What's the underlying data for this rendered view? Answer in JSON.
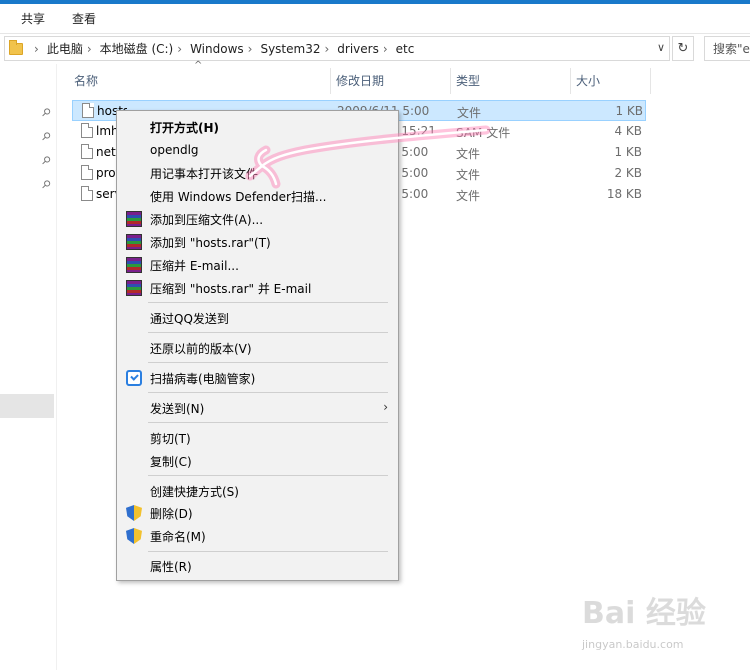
{
  "ribbon": {
    "tabs": [
      "共享",
      "查看"
    ]
  },
  "address": {
    "crumbs": [
      "此电脑",
      "本地磁盘 (C:)",
      "Windows",
      "System32",
      "drivers",
      "etc"
    ],
    "separator": "›",
    "dropdown_glyph": "∨",
    "refresh_glyph": "↻"
  },
  "search": {
    "text": "搜索\"e"
  },
  "columns": {
    "name": "名称",
    "date": "修改日期",
    "type": "类型",
    "size": "大小",
    "sort_glyph": "^"
  },
  "files": [
    {
      "name": "hosts",
      "date": "2009/6/11 5:00",
      "type": "文件",
      "size": "1 KB"
    },
    {
      "name": "lmhosts.sam",
      "date": "2009/6/11 15:21",
      "type": "SAM 文件",
      "size": "4 KB"
    },
    {
      "name": "networks",
      "date": "2009/6/11 5:00",
      "type": "文件",
      "size": "1 KB"
    },
    {
      "name": "protocol",
      "date": "2009/6/11 5:00",
      "type": "文件",
      "size": "2 KB"
    },
    {
      "name": "services",
      "date": "2009/6/11 5:00",
      "type": "文件",
      "size": "18 KB"
    }
  ],
  "context_menu": {
    "open_with": "打开方式(H)",
    "opendlg": "opendlg",
    "open_notepad": "用记事本打开该文件",
    "defender": "使用 Windows Defender扫描...",
    "rar_add": "添加到压缩文件(A)...",
    "rar_add_hosts": "添加到 \"hosts.rar\"(T)",
    "rar_email": "压缩并 E-mail...",
    "rar_hosts_email": "压缩到 \"hosts.rar\" 并 E-mail",
    "send_qq": "通过QQ发送到",
    "restore": "还原以前的版本(V)",
    "scan_virus": "扫描病毒(电脑管家)",
    "send_to": "发送到(N)",
    "cut": "剪切(T)",
    "copy": "复制(C)",
    "create_shortcut": "创建快捷方式(S)",
    "delete": "删除(D)",
    "rename": "重命名(M)",
    "properties": "属性(R)",
    "submenu_glyph": "›"
  },
  "watermark": {
    "text": "Bai 经验",
    "sub": "jingyan.baidu.com"
  },
  "colors": {
    "accent": "#1979ca",
    "selection": "#cce8ff",
    "annotation": "#ff4f9a"
  }
}
